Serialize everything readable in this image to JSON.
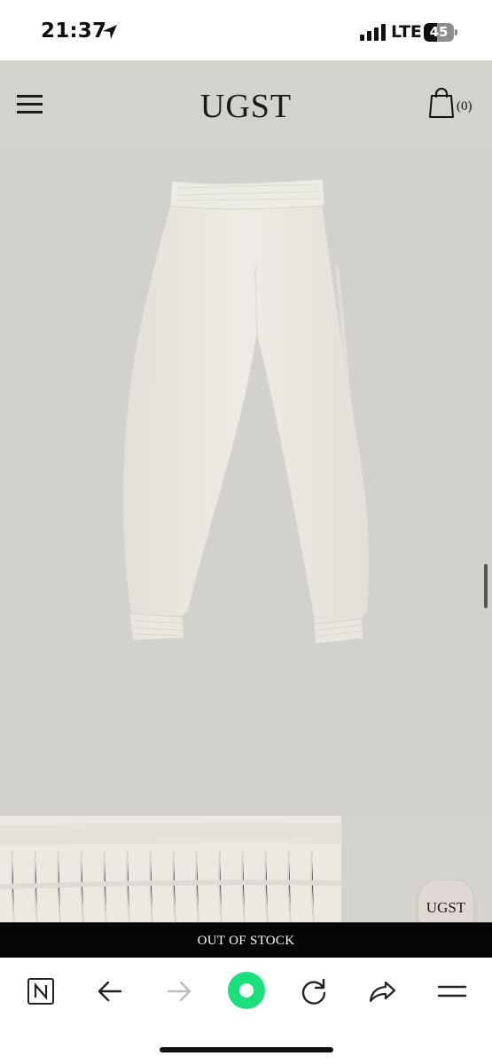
{
  "status_bar": {
    "time": "21:37",
    "network": "LTE",
    "battery_percent": "45",
    "battery_level": 0.45
  },
  "header": {
    "brand": "UGST",
    "cart_count": "(0)"
  },
  "product": {
    "status_label": "OUT OF STOCK"
  },
  "floating": {
    "brand_button_label": "UGST"
  },
  "icons": {
    "menu": "hamburger-icon",
    "cart": "shopping-bag-icon",
    "location": "location-arrow-icon",
    "signal": "cellular-signal-icon",
    "naver": "naver-n-icon",
    "back": "arrow-left-icon",
    "forward": "arrow-right-icon",
    "green_dot": "green-circle-icon",
    "refresh": "refresh-icon",
    "share": "share-icon",
    "more_menu": "menu-lines-icon"
  },
  "colors": {
    "background": "#d4d2cd",
    "garment": "#ebe9e2",
    "accent_green": "#19e07b",
    "bar_black": "#050505"
  }
}
